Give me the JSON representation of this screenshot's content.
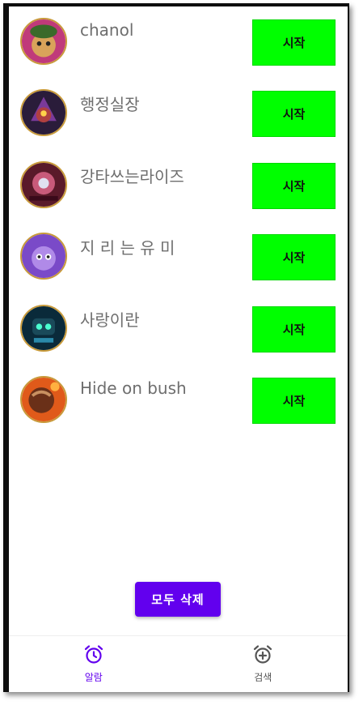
{
  "alarm_list": [
    {
      "name": "chanol",
      "start_label": "시작"
    },
    {
      "name": "행정실장",
      "start_label": "시작"
    },
    {
      "name": "강타쓰는라이즈",
      "start_label": "시작"
    },
    {
      "name": "지 리 는 유 미",
      "start_label": "시작"
    },
    {
      "name": "사랑이란",
      "start_label": "시작"
    },
    {
      "name": "Hide on bush",
      "start_label": "시작"
    }
  ],
  "delete_all_label": "모두 삭제",
  "bottom_nav": {
    "items": [
      {
        "label": "알람",
        "icon": "alarm-clock-icon",
        "active": true
      },
      {
        "label": "검색",
        "icon": "add-alarm-icon",
        "active": false
      }
    ]
  },
  "colors": {
    "start_button": "#00ff00",
    "primary": "#6200ee",
    "inactive_nav": "#555555"
  }
}
